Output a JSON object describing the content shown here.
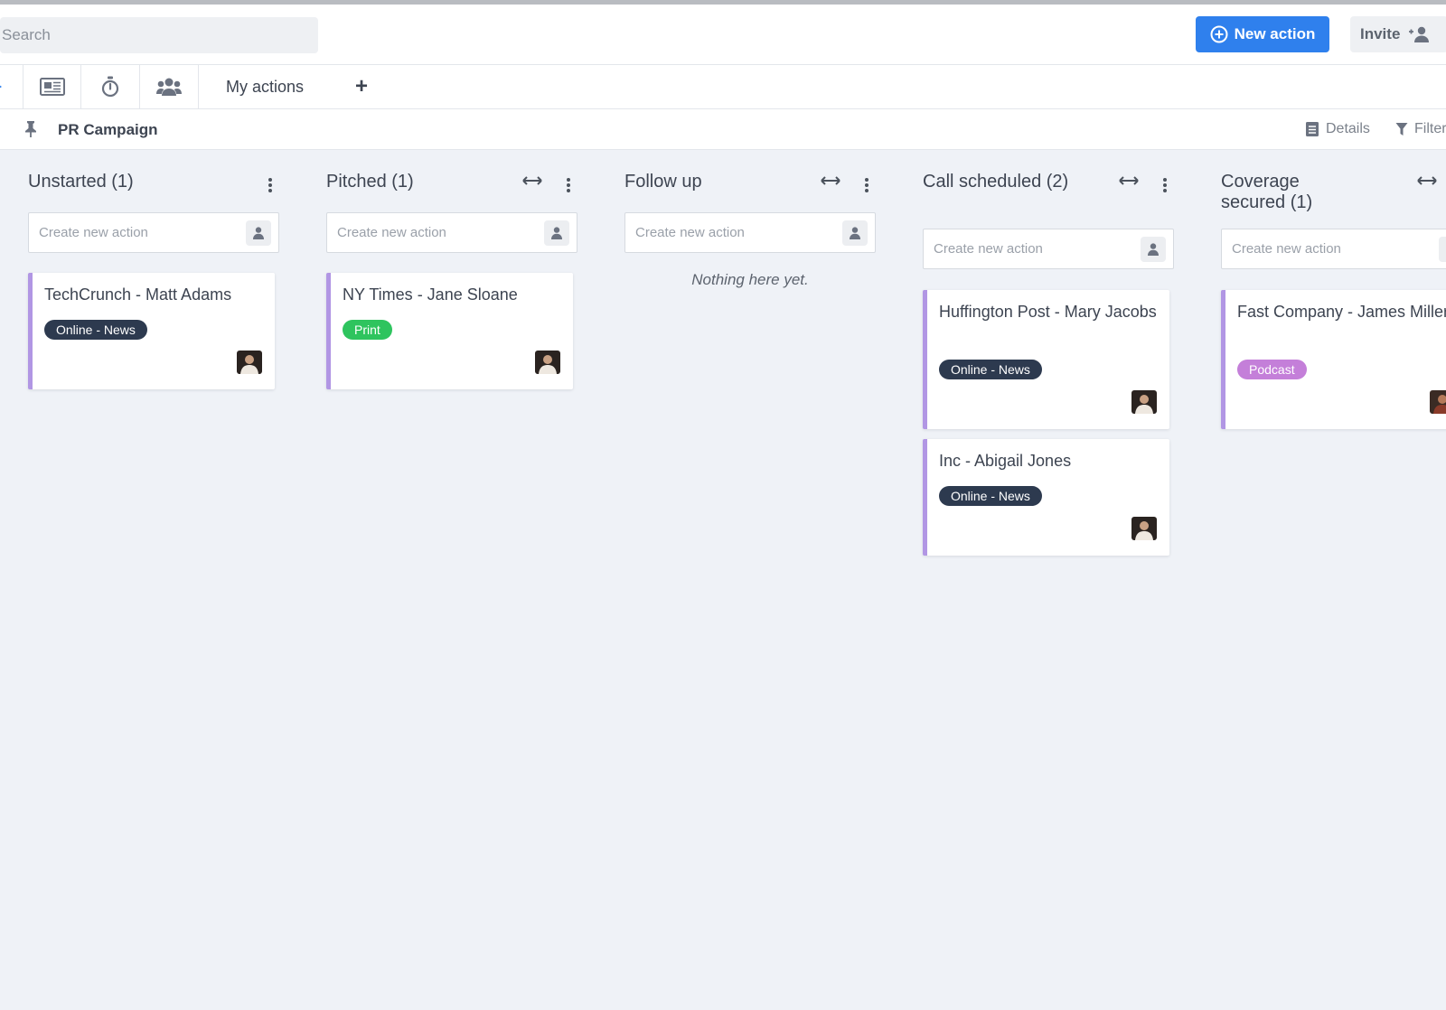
{
  "header": {
    "search_placeholder": "Search",
    "new_action_label": "New action",
    "invite_label": "Invite"
  },
  "toolbar": {
    "icons": [
      "list-view-icon",
      "newspaper-icon",
      "stopwatch-icon",
      "team-icon"
    ],
    "my_actions_label": "My actions",
    "add_label": "+"
  },
  "project": {
    "title": "PR Campaign",
    "details_label": "Details",
    "filter_label": "Filter"
  },
  "board": {
    "create_placeholder": "Create new action",
    "empty_text": "Nothing here yet.",
    "columns": [
      {
        "title": "Unstarted (1)"
      },
      {
        "title": "Pitched (1)"
      },
      {
        "title": "Follow up"
      },
      {
        "title": "Call scheduled (2)"
      },
      {
        "title": "Coverage secured (1)"
      }
    ],
    "cards": [
      {
        "title": "TechCrunch - Matt Adams",
        "tag": "Online - News"
      },
      {
        "title": "NY Times - Jane Sloane",
        "tag": "Print"
      },
      {
        "title": "Huffington Post - Mary Jacobs",
        "tag": "Online - News"
      },
      {
        "title": "Inc - Abigail Jones",
        "tag": "Online - News"
      },
      {
        "title": "Fast Company - James Miller",
        "tag": "Podcast"
      }
    ]
  },
  "colors": {
    "primary": "#2f80ed",
    "card_accent": "#b196e4",
    "tag_online_news": "#2d3a4f",
    "tag_print": "#2ec45e",
    "tag_podcast": "#c47fd9",
    "board_background": "#eff2f7"
  }
}
